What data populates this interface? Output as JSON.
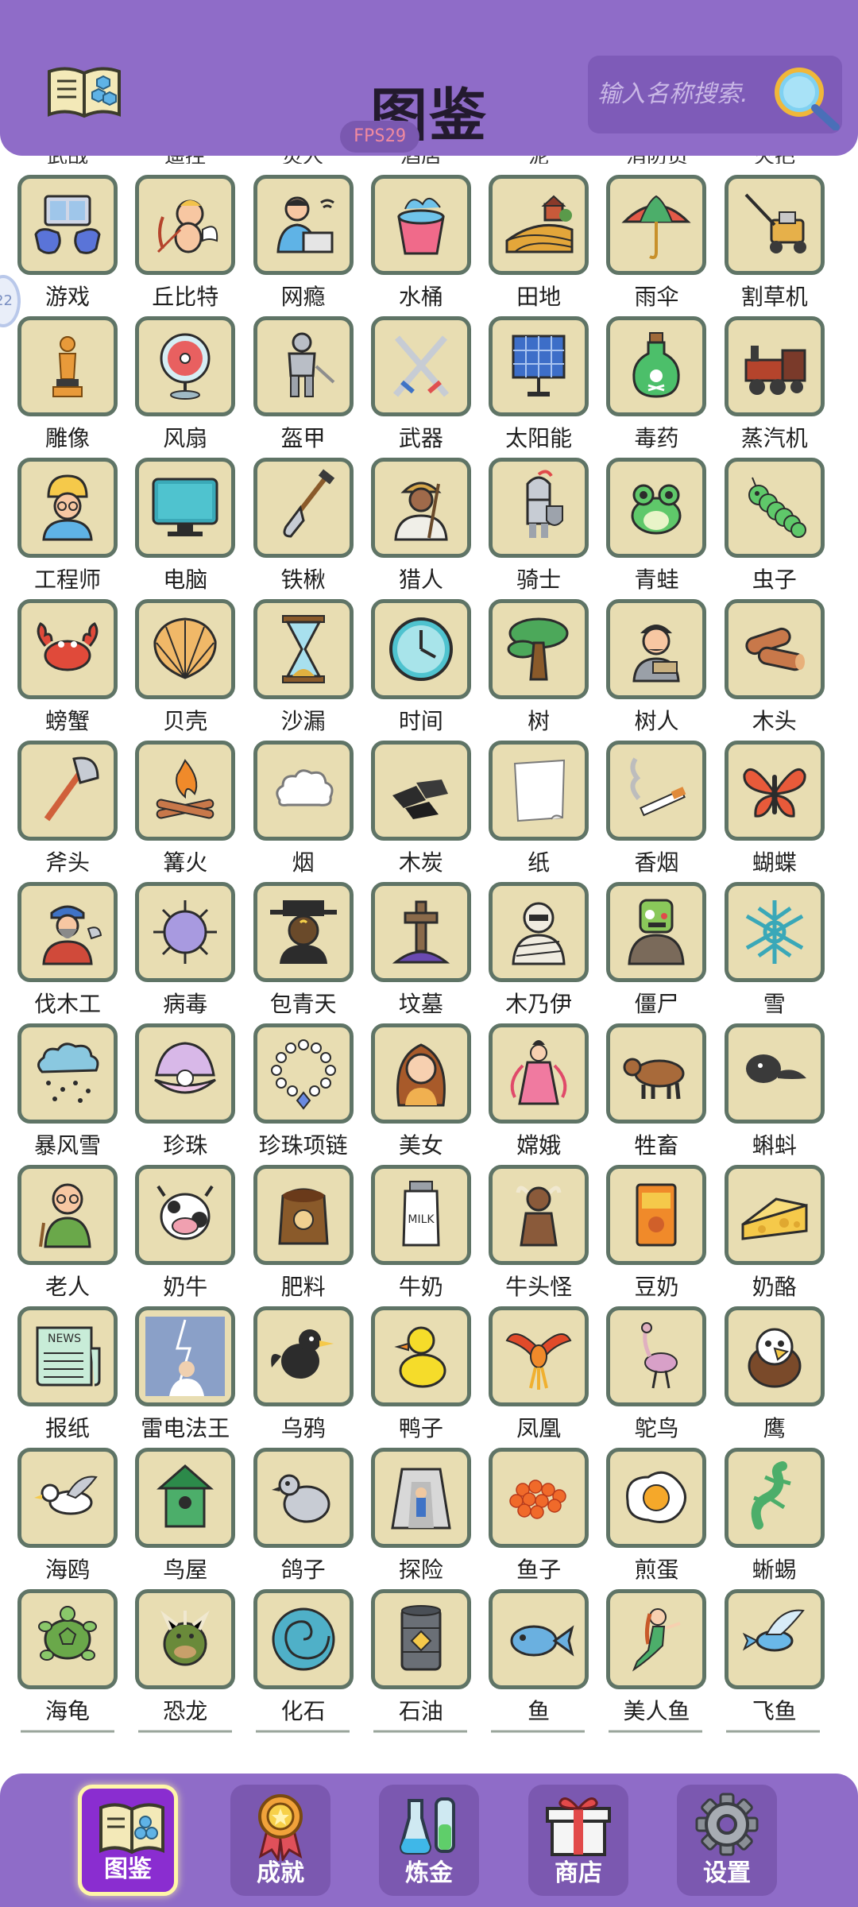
{
  "header": {
    "title": "图鉴",
    "search_placeholder": "输入名称搜索.",
    "fps": "FPS29",
    "partial_row_labels": [
      "武战",
      "遥控",
      "灵人",
      "酒店",
      "泥",
      "消防员",
      "火把"
    ]
  },
  "edge_bubble": "22",
  "items": [
    {
      "label": "游戏",
      "icon": "game-icon"
    },
    {
      "label": "丘比特",
      "icon": "cupid-icon"
    },
    {
      "label": "网瘾",
      "icon": "internet-addict-icon"
    },
    {
      "label": "水桶",
      "icon": "bucket-icon"
    },
    {
      "label": "田地",
      "icon": "farmland-icon"
    },
    {
      "label": "雨伞",
      "icon": "umbrella-icon"
    },
    {
      "label": "割草机",
      "icon": "lawnmower-icon"
    },
    {
      "label": "雕像",
      "icon": "statue-icon"
    },
    {
      "label": "风扇",
      "icon": "fan-icon"
    },
    {
      "label": "盔甲",
      "icon": "armor-icon"
    },
    {
      "label": "武器",
      "icon": "weapon-icon"
    },
    {
      "label": "太阳能",
      "icon": "solar-panel-icon"
    },
    {
      "label": "毒药",
      "icon": "poison-icon"
    },
    {
      "label": "蒸汽机",
      "icon": "steam-engine-icon"
    },
    {
      "label": "工程师",
      "icon": "engineer-icon"
    },
    {
      "label": "电脑",
      "icon": "computer-icon"
    },
    {
      "label": "铁楸",
      "icon": "shovel-icon"
    },
    {
      "label": "猎人",
      "icon": "hunter-icon"
    },
    {
      "label": "骑士",
      "icon": "knight-icon"
    },
    {
      "label": "青蛙",
      "icon": "frog-icon"
    },
    {
      "label": "虫子",
      "icon": "caterpillar-icon"
    },
    {
      "label": "螃蟹",
      "icon": "crab-icon"
    },
    {
      "label": "贝壳",
      "icon": "shell-icon"
    },
    {
      "label": "沙漏",
      "icon": "hourglass-icon"
    },
    {
      "label": "时间",
      "icon": "clock-icon"
    },
    {
      "label": "树",
      "icon": "tree-icon"
    },
    {
      "label": "树人",
      "icon": "tree-man-icon"
    },
    {
      "label": "木头",
      "icon": "wood-logs-icon"
    },
    {
      "label": "斧头",
      "icon": "axe-icon"
    },
    {
      "label": "篝火",
      "icon": "campfire-icon"
    },
    {
      "label": "烟",
      "icon": "smoke-icon"
    },
    {
      "label": "木炭",
      "icon": "charcoal-icon"
    },
    {
      "label": "纸",
      "icon": "paper-icon"
    },
    {
      "label": "香烟",
      "icon": "cigarette-icon"
    },
    {
      "label": "蝴蝶",
      "icon": "butterfly-icon"
    },
    {
      "label": "伐木工",
      "icon": "lumberjack-icon"
    },
    {
      "label": "病毒",
      "icon": "virus-icon"
    },
    {
      "label": "包青天",
      "icon": "judge-bao-icon"
    },
    {
      "label": "坟墓",
      "icon": "grave-icon"
    },
    {
      "label": "木乃伊",
      "icon": "mummy-icon"
    },
    {
      "label": "僵尸",
      "icon": "zombie-icon"
    },
    {
      "label": "雪",
      "icon": "snowflake-icon"
    },
    {
      "label": "暴风雪",
      "icon": "blizzard-icon"
    },
    {
      "label": "珍珠",
      "icon": "pearl-icon"
    },
    {
      "label": "珍珠项链",
      "icon": "pearl-necklace-icon"
    },
    {
      "label": "美女",
      "icon": "beauty-icon"
    },
    {
      "label": "嫦娥",
      "icon": "change-goddess-icon"
    },
    {
      "label": "牲畜",
      "icon": "livestock-icon"
    },
    {
      "label": "蝌蚪",
      "icon": "tadpole-icon"
    },
    {
      "label": "老人",
      "icon": "old-man-icon"
    },
    {
      "label": "奶牛",
      "icon": "cow-icon"
    },
    {
      "label": "肥料",
      "icon": "fertilizer-icon"
    },
    {
      "label": "牛奶",
      "icon": "milk-icon"
    },
    {
      "label": "牛头怪",
      "icon": "minotaur-icon"
    },
    {
      "label": "豆奶",
      "icon": "soy-milk-icon"
    },
    {
      "label": "奶酪",
      "icon": "cheese-icon"
    },
    {
      "label": "报纸",
      "icon": "newspaper-icon"
    },
    {
      "label": "雷电法王",
      "icon": "thunder-king-icon"
    },
    {
      "label": "乌鸦",
      "icon": "crow-icon"
    },
    {
      "label": "鸭子",
      "icon": "duck-icon"
    },
    {
      "label": "凤凰",
      "icon": "phoenix-icon"
    },
    {
      "label": "鸵鸟",
      "icon": "ostrich-icon"
    },
    {
      "label": "鹰",
      "icon": "eagle-icon"
    },
    {
      "label": "海鸥",
      "icon": "seagull-icon"
    },
    {
      "label": "鸟屋",
      "icon": "birdhouse-icon"
    },
    {
      "label": "鸽子",
      "icon": "pigeon-icon"
    },
    {
      "label": "探险",
      "icon": "explore-icon"
    },
    {
      "label": "鱼子",
      "icon": "roe-icon"
    },
    {
      "label": "煎蛋",
      "icon": "fried-egg-icon"
    },
    {
      "label": "蜥蜴",
      "icon": "lizard-icon"
    },
    {
      "label": "海龟",
      "icon": "turtle-icon"
    },
    {
      "label": "恐龙",
      "icon": "dinosaur-icon"
    },
    {
      "label": "化石",
      "icon": "fossil-icon"
    },
    {
      "label": "石油",
      "icon": "oil-barrel-icon"
    },
    {
      "label": "鱼",
      "icon": "fish-icon"
    },
    {
      "label": "美人鱼",
      "icon": "mermaid-icon"
    },
    {
      "label": "飞鱼",
      "icon": "flying-fish-icon"
    }
  ],
  "nav": [
    {
      "label": "图鉴",
      "icon": "book-icon",
      "active": true
    },
    {
      "label": "成就",
      "icon": "medal-icon",
      "active": false
    },
    {
      "label": "炼金",
      "icon": "flask-icon",
      "active": false
    },
    {
      "label": "商店",
      "icon": "gift-icon",
      "active": false
    },
    {
      "label": "设置",
      "icon": "gear-icon",
      "active": false
    }
  ],
  "colors": {
    "header_bg": "#8f6cc8",
    "tile_bg": "#e8ddb2",
    "tile_border": "#5f7466",
    "nav_active_bg": "#8a2dd0",
    "nav_active_border": "#fff6a8"
  }
}
